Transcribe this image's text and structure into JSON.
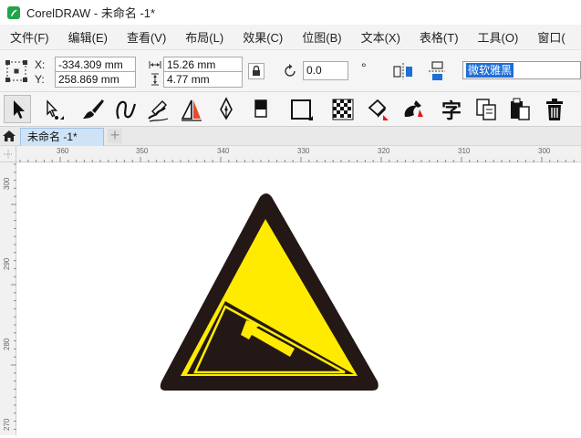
{
  "window": {
    "title": "CorelDRAW - 未命名 -1*"
  },
  "menu": {
    "items": [
      "文件(F)",
      "编辑(E)",
      "查看(V)",
      "布局(L)",
      "效果(C)",
      "位图(B)",
      "文本(X)",
      "表格(T)",
      "工具(O)",
      "窗口("
    ]
  },
  "properties": {
    "x_label": "X:",
    "x_value": "-334.309 mm",
    "y_label": "Y:",
    "y_value": "258.869 mm",
    "width_value": "15.26 mm",
    "height_value": "4.77 mm",
    "angle_value": "0.0",
    "degree_symbol": "°",
    "font_name": "微软雅黑"
  },
  "document": {
    "tab_label": "未命名 -1*",
    "add_tab": "+"
  },
  "ruler": {
    "h_ticks": [
      "360",
      "350",
      "340",
      "330",
      "320",
      "310",
      "300"
    ],
    "v_ticks": [
      "300",
      "290",
      "280",
      "270"
    ]
  },
  "colors": {
    "sign_fill": "#ffeb00",
    "sign_dark": "#231815",
    "accent": "#1e6fd6"
  }
}
